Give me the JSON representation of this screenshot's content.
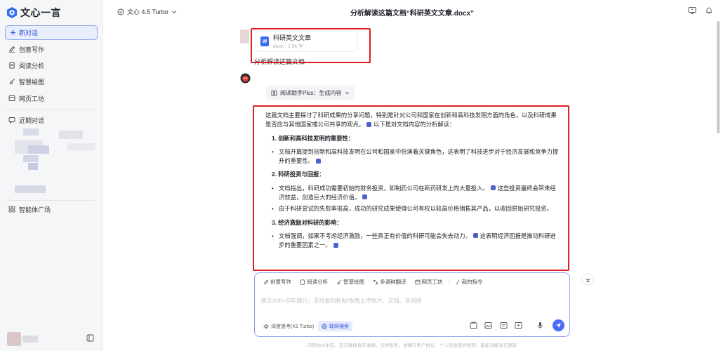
{
  "app": {
    "name": "文心一言"
  },
  "sidebar": {
    "new_chat": "新对话",
    "items": [
      {
        "label": "创意写作",
        "icon": "pen-icon"
      },
      {
        "label": "阅读分析",
        "icon": "document-icon"
      },
      {
        "label": "智慧绘图",
        "icon": "brush-icon"
      },
      {
        "label": "网页工坊",
        "icon": "web-icon"
      }
    ],
    "recent_label": "近期对话",
    "agent_square": "智能体广场"
  },
  "header": {
    "model": "文心 4.5 Turbo",
    "title": "分析解读这篇文档“科研英文文章.docx”"
  },
  "user_message": {
    "file_name": "科研英文文章",
    "file_meta": "docx · 1.6k 字",
    "file_badge": "W",
    "text": "分析解读这篇文档"
  },
  "assistant": {
    "chip": "阅读助手Plus：生成内容",
    "intro": "这篇文档主要探讨了科研成果的分享问题，特别是针对公司和国家在创新和高科技发明方面的角色，以及科研成果是否应与其他国家或公司共享的观点。",
    "intro_tail": "以下是对文档内容的分析解读：",
    "sections": [
      {
        "heading": "1. 创新和高科技发明的重要性：",
        "bullets": [
          "文档开篇提到创新和高科技发明在公司和国家中扮演着关键角色，这表明了科技进步对于经济发展和竞争力提升的重要性。"
        ]
      },
      {
        "heading": "2. 科研投资与回报：",
        "bullets": [
          "文档指出，科研成功需要初始的财务投资，如制药公司在新药研发上的大量投入。",
          "这些投资最终会带来经济效益，创造巨大的经济价值。",
          "由于科研尝试的失败率很高，成功的研究成果使得公司有权以较高价格销售其产品，以收回原始研究投资。"
        ]
      },
      {
        "heading": "3. 经济激励对科研的影响：",
        "bullets": [
          "文档强调，如果不考虑经济激励，一些真正有价值的科研可能会失去动力。",
          "这表明经济回报是推动科研进步的重要因素之一。"
        ]
      }
    ]
  },
  "composer": {
    "tools": [
      "创意写作",
      "阅读分析",
      "智慧绘图",
      "多语种翻译",
      "网页工坊",
      "我的指令"
    ],
    "placeholder": "通过shift+回车换行；支持复制粘贴/拖拽上传图片、文档、音视频",
    "deep_think": "深度思考(X1 Turbo)",
    "web_search": "联网搜索"
  },
  "footer": "内容由AI生成，无法确保真实准确，仅供参考，请遵守用户协议、个人信息保护规则，最新功能详见更新"
}
